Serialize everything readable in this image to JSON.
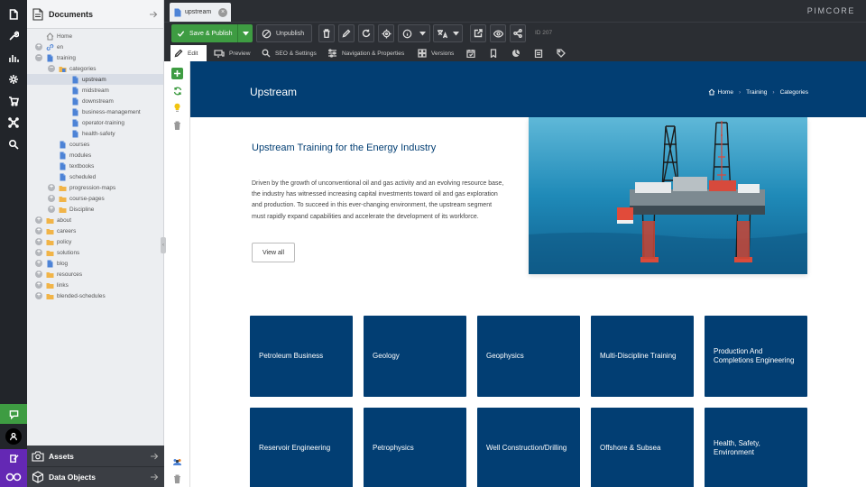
{
  "app": {
    "brand": "PIMCORE",
    "accent": "#3e9c42",
    "dark": "#2b2e33",
    "navy": "#023e73"
  },
  "leftbar": {
    "icons": [
      "file-icon",
      "wrench-icon",
      "chart-icon",
      "gear-icon",
      "cart-icon",
      "network-icon",
      "search-icon"
    ]
  },
  "tree": {
    "title": "Documents",
    "nodes": [
      {
        "label": "Home",
        "type": "home",
        "indent": 0,
        "exp": "blank"
      },
      {
        "label": "en",
        "type": "link",
        "indent": 0,
        "exp": "+"
      },
      {
        "label": "training",
        "type": "page",
        "indent": 0,
        "exp": "-"
      },
      {
        "label": "categories",
        "type": "folderpage",
        "indent": 1,
        "exp": "-"
      },
      {
        "label": "upstream",
        "type": "page",
        "indent": 2,
        "exp": "blank",
        "selected": true
      },
      {
        "label": "midstream",
        "type": "page",
        "indent": 2,
        "exp": "blank"
      },
      {
        "label": "downstream",
        "type": "page",
        "indent": 2,
        "exp": "blank"
      },
      {
        "label": "business-management",
        "type": "page",
        "indent": 2,
        "exp": "blank"
      },
      {
        "label": "operator-training",
        "type": "page",
        "indent": 2,
        "exp": "blank"
      },
      {
        "label": "health-safety",
        "type": "page",
        "indent": 2,
        "exp": "blank"
      },
      {
        "label": "courses",
        "type": "page",
        "indent": 1,
        "exp": "blank"
      },
      {
        "label": "modules",
        "type": "page",
        "indent": 1,
        "exp": "blank"
      },
      {
        "label": "textbooks",
        "type": "page",
        "indent": 1,
        "exp": "blank"
      },
      {
        "label": "scheduled",
        "type": "page",
        "indent": 1,
        "exp": "blank"
      },
      {
        "label": "progression-maps",
        "type": "folder",
        "indent": 1,
        "exp": "+"
      },
      {
        "label": "course-pages",
        "type": "folder",
        "indent": 1,
        "exp": "+"
      },
      {
        "label": "Discipline",
        "type": "folder",
        "indent": 1,
        "exp": "+"
      },
      {
        "label": "about",
        "type": "folder",
        "indent": 0,
        "exp": "+"
      },
      {
        "label": "careers",
        "type": "folder",
        "indent": 0,
        "exp": "+"
      },
      {
        "label": "policy",
        "type": "folder",
        "indent": 0,
        "exp": "+"
      },
      {
        "label": "solutions",
        "type": "folder",
        "indent": 0,
        "exp": "+"
      },
      {
        "label": "blog",
        "type": "page",
        "indent": 0,
        "exp": "+"
      },
      {
        "label": "resources",
        "type": "folder",
        "indent": 0,
        "exp": "+"
      },
      {
        "label": "links",
        "type": "folder",
        "indent": 0,
        "exp": "+"
      },
      {
        "label": "blended-schedules",
        "type": "folder",
        "indent": 0,
        "exp": "+"
      }
    ]
  },
  "panels": {
    "assets": "Assets",
    "objects": "Data Objects"
  },
  "tab": {
    "label": "upstream"
  },
  "toolbar": {
    "publish": "Save & Publish",
    "unpublish": "Unpublish",
    "doc_id": "ID 207"
  },
  "subtabs": {
    "edit": "Edit",
    "preview": "Preview",
    "seo": "SEO & Settings",
    "nav": "Navigation & Properties",
    "versions": "Versions"
  },
  "page": {
    "hero_title": "Upstream",
    "breadcrumb": [
      "Home",
      "Training",
      "Categories"
    ],
    "intro_title": "Upstream Training for the Energy Industry",
    "intro_text": "Driven by the growth of unconventional oil and gas activity and an evolving resource base, the industry has witnessed increasing capital investments toward oil and gas exploration and production. To succeed in this ever-changing environment, the upstream segment must rapidly expand capabilities and accelerate the development of its workforce.",
    "view_all": "View all",
    "cards": [
      "Petroleum Business",
      "Geology",
      "Geophysics",
      "Multi-Discipline Training",
      "Production And Completions Engineering",
      "Reservoir Engineering",
      "Petrophysics",
      "Well Construction/Drilling",
      "Offshore & Subsea",
      "Health, Safety, Environment"
    ]
  }
}
